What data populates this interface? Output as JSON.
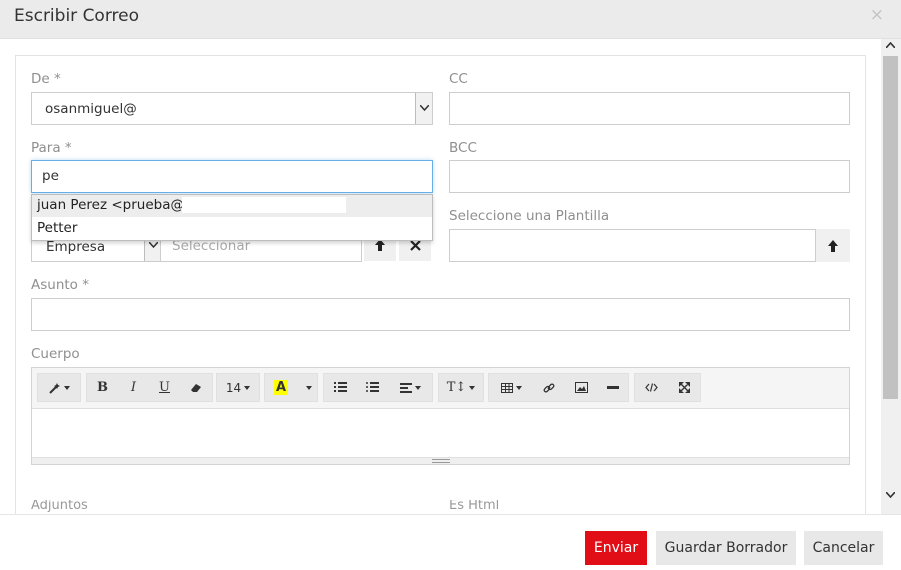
{
  "header": {
    "title": "Escribir Correo",
    "close_glyph": "×"
  },
  "form": {
    "from": {
      "label": "De *",
      "value": "osanmiguel@"
    },
    "cc": {
      "label": "CC",
      "value": ""
    },
    "to": {
      "label": "Para *",
      "value": "pe"
    },
    "bcc": {
      "label": "BCC",
      "value": ""
    },
    "autocomplete": [
      {
        "text": "juan Perez <prueba@"
      },
      {
        "text": "Petter"
      }
    ],
    "company": {
      "value": "Empresa",
      "placeholder": "Seleccionar"
    },
    "template": {
      "label": "Seleccione una Plantilla",
      "value": ""
    },
    "subject": {
      "label": "Asunto *",
      "value": ""
    },
    "body": {
      "label": "Cuerpo"
    },
    "attachments_label": "Adjuntos",
    "html_label": "Es Html"
  },
  "editor_toolbar": {
    "font_size": "14",
    "highlight_letter": "A",
    "bold": "B",
    "italic": "I",
    "underline": "U",
    "text_height": "T↕",
    "icons": [
      "magic-wand-icon",
      "bold-icon",
      "italic-icon",
      "underline-icon",
      "eraser-icon",
      "font-size-icon",
      "color-icon",
      "ordered-list-icon",
      "unordered-list-icon",
      "align-icon",
      "line-height-icon",
      "table-icon",
      "link-icon",
      "picture-icon",
      "horizontal-rule-icon",
      "code-view-icon",
      "fullscreen-icon"
    ]
  },
  "footer": {
    "send_label": "Enviar",
    "draft_label": "Guardar Borrador",
    "cancel_label": "Cancelar"
  },
  "colors": {
    "primary": "#e10e17",
    "focus": "#66afe9",
    "highlight": "#ffff00"
  }
}
